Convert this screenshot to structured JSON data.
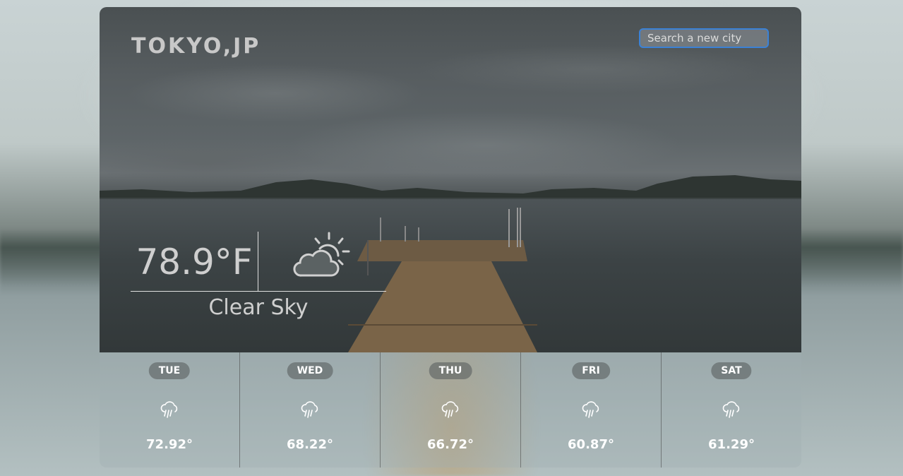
{
  "header": {
    "city": "TOKYO,JP",
    "search_placeholder": "Search a new city"
  },
  "current": {
    "temperature": "78.9°F",
    "description": "Clear Sky",
    "icon": "partly-sunny-icon"
  },
  "forecast": [
    {
      "day": "TUE",
      "temp": "72.92°",
      "icon": "rain-cloud-icon"
    },
    {
      "day": "WED",
      "temp": "68.22°",
      "icon": "rain-cloud-icon"
    },
    {
      "day": "THU",
      "temp": "66.72°",
      "icon": "rain-cloud-icon"
    },
    {
      "day": "FRI",
      "temp": "60.87°",
      "icon": "rain-cloud-icon"
    },
    {
      "day": "SAT",
      "temp": "61.29°",
      "icon": "rain-cloud-icon"
    }
  ],
  "colors": {
    "search_border": "#3b82d6",
    "text_light": "#cfcfcf",
    "forecast_text": "#ffffff"
  }
}
